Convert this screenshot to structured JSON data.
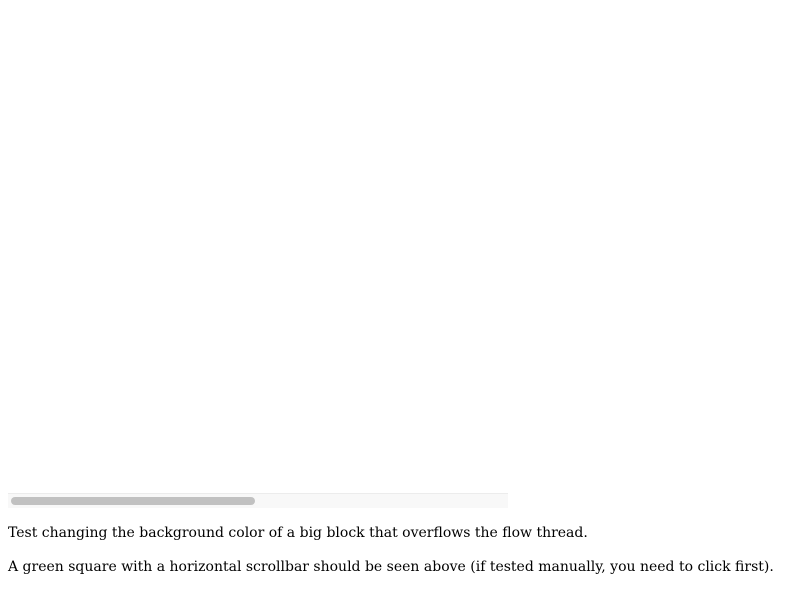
{
  "flow_thread": {
    "scroll_position": 0
  },
  "text": {
    "line1": "Test changing the background color of a big block that overflows the flow thread.",
    "line2": "A green square with a horizontal scrollbar should be seen above (if tested manually, you need to click first)."
  }
}
